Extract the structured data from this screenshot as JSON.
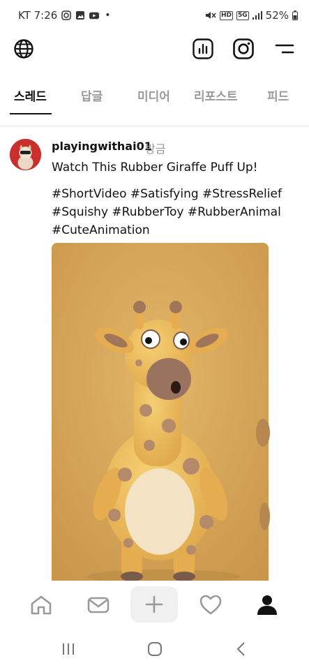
{
  "status_bar": {
    "carrier_time": "KT 7:26",
    "extra_dot": "•",
    "hd_label": "HD",
    "network_label": "5G",
    "battery": "52%"
  },
  "tabs": [
    {
      "label": "스레드",
      "active": true
    },
    {
      "label": "답글",
      "active": false
    },
    {
      "label": "미디어",
      "active": false
    },
    {
      "label": "리포스트",
      "active": false
    },
    {
      "label": "피드",
      "active": false
    }
  ],
  "post": {
    "username": "playingwithai01",
    "time": "방금",
    "title": "Watch This Rubber Giraffe Puff Up!",
    "hashtags_line1": "#ShortVideo #Satisfying #StressRelief",
    "hashtags_line2": "#Squishy #RubberToy #RubberAnimal",
    "hashtags_line3": "#CuteAnimation",
    "media_alt": "Rubber giraffe toy"
  },
  "colors": {
    "accent": "#111111",
    "inactive_tab": "#9a9a9a",
    "media_bg": "#d6a85a",
    "avatar_bg": "#c9302c"
  },
  "icons": {
    "header": [
      "globe-icon",
      "insights-icon",
      "instagram-icon",
      "menu-icon"
    ],
    "bottom_nav": [
      "home-icon",
      "messages-icon",
      "add-icon",
      "heart-icon",
      "profile-icon"
    ],
    "system": [
      "recent-apps-icon",
      "home-circle-icon",
      "back-icon"
    ]
  }
}
